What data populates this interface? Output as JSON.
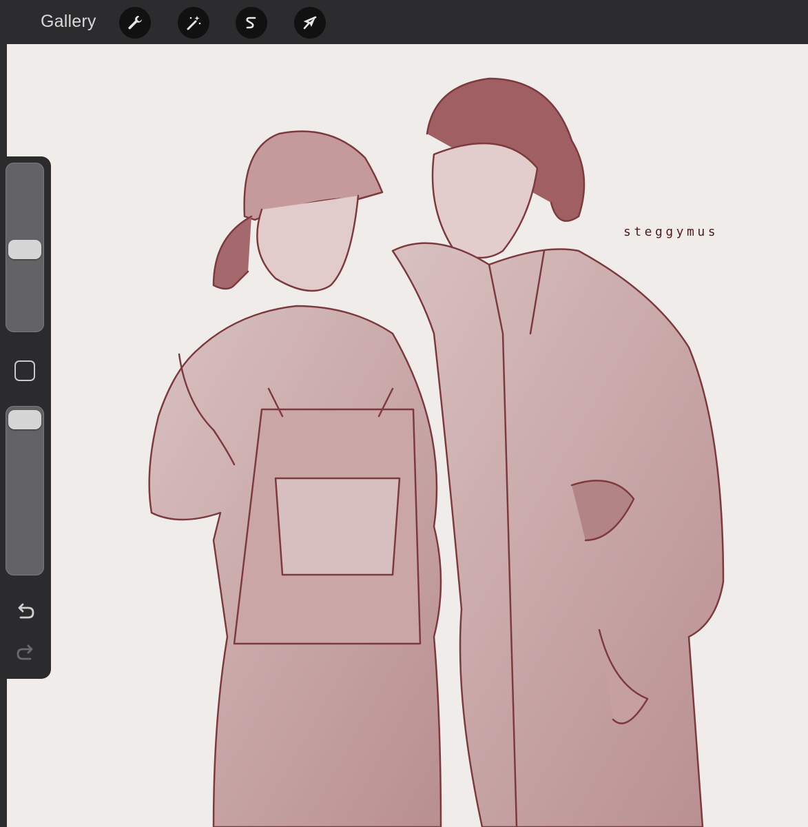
{
  "toolbar": {
    "gallery_label": "Gallery",
    "tools": [
      {
        "name": "actions",
        "icon": "wrench-icon"
      },
      {
        "name": "adjustments",
        "icon": "magic-wand-icon"
      },
      {
        "name": "selection",
        "icon": "selection-s-icon"
      },
      {
        "name": "transform",
        "icon": "arrow-cursor-icon"
      }
    ]
  },
  "canvas": {
    "signature": "steggymus",
    "ink_color": "#7d3a3e",
    "paper_color": "#efecea"
  },
  "sidebar": {
    "brush_size": 0.55,
    "opacity": 0.95,
    "undo_icon": "undo-icon",
    "redo_icon": "redo-icon"
  }
}
